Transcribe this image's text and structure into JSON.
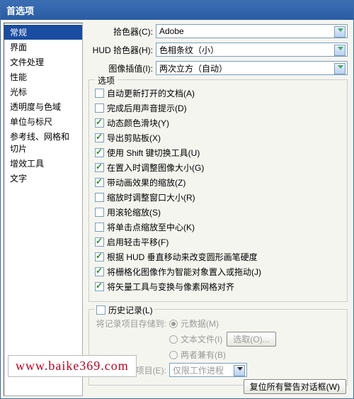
{
  "title": "首选项",
  "sidebar": {
    "items": [
      {
        "label": "常规",
        "selected": true
      },
      {
        "label": "界面"
      },
      {
        "label": "文件处理"
      },
      {
        "label": "性能"
      },
      {
        "label": "光标"
      },
      {
        "label": "透明度与色域"
      },
      {
        "label": "单位与标尺"
      },
      {
        "label": "参考线、网格和切片"
      },
      {
        "label": "增效工具"
      },
      {
        "label": "文字"
      }
    ]
  },
  "top": {
    "picker_label": "拾色器(C):",
    "picker_value": "Adobe",
    "hud_label": "HUD 拾色器(H):",
    "hud_value": "色相条纹（小）",
    "interp_label": "图像插值(I):",
    "interp_value": "两次立方（自动）"
  },
  "options": {
    "legend": "选项",
    "items": [
      {
        "label": "自动更新打开的文档(A)",
        "checked": false
      },
      {
        "label": "完成后用声音提示(D)",
        "checked": false
      },
      {
        "label": "动态颜色滑块(Y)",
        "checked": true
      },
      {
        "label": "导出剪贴板(X)",
        "checked": true
      },
      {
        "label": "使用 Shift 键切换工具(U)",
        "checked": true
      },
      {
        "label": "在置入时调整图像大小(G)",
        "checked": true
      },
      {
        "label": "带动画效果的缩放(Z)",
        "checked": true
      },
      {
        "label": "缩放时调整窗口大小(R)",
        "checked": false
      },
      {
        "label": "用滚轮缩放(S)",
        "checked": false
      },
      {
        "label": "将单击点缩放至中心(K)",
        "checked": false
      },
      {
        "label": "启用轻击平移(F)",
        "checked": true
      },
      {
        "label": "根据 HUD 垂直移动来改变圆形画笔硬度",
        "checked": true
      },
      {
        "label": "将栅格化图像作为智能对象置入或拖动(J)",
        "checked": true
      },
      {
        "label": "将矢量工具与变换与像素网格对齐",
        "checked": true
      }
    ]
  },
  "history": {
    "legend": "历史记录(L)",
    "save_label": "将记录项目存储到:",
    "radios": [
      {
        "label": "元数据(M)",
        "selected": true
      },
      {
        "label": "文本文件(I)",
        "selected": false
      },
      {
        "label": "两者兼有(B)",
        "selected": false
      }
    ],
    "choose_btn": "选取(O)...",
    "edit_label": "编辑记录项目(E):",
    "edit_value": "仅限工作进程"
  },
  "reset_btn": "复位所有警告对话框(W)",
  "watermark": "www.baike369.com"
}
